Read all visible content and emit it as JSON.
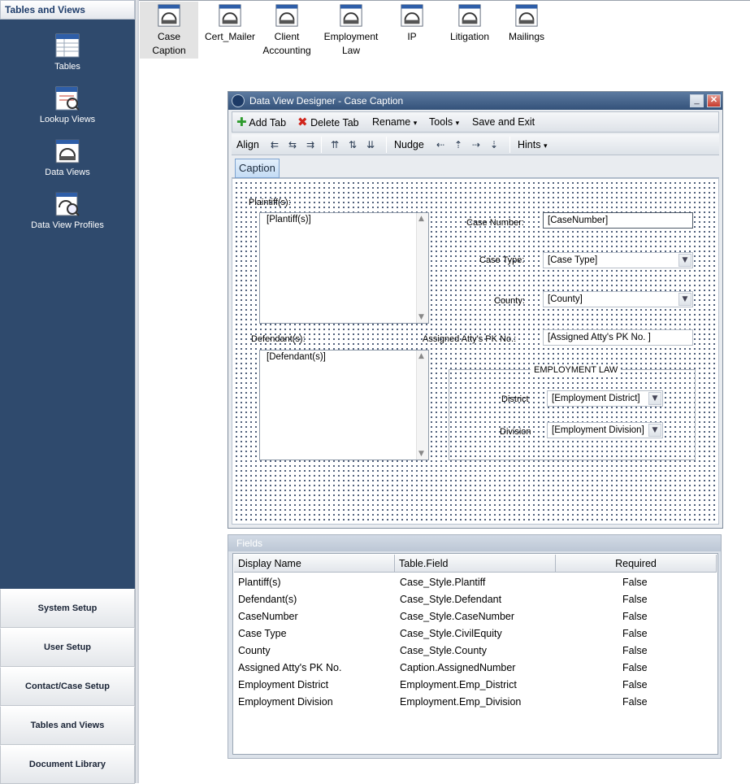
{
  "left_nav": {
    "header": "Tables and Views",
    "icon_items": [
      {
        "label": "Tables",
        "icon": "table-icon"
      },
      {
        "label": "Lookup Views",
        "icon": "lookup-view-icon"
      },
      {
        "label": "Data Views",
        "icon": "data-view-icon"
      },
      {
        "label": "Data View Profiles",
        "icon": "data-view-profile-icon"
      }
    ],
    "buttons": [
      "System Setup",
      "User Setup",
      "Contact/Case Setup",
      "Tables and Views",
      "Document Library"
    ]
  },
  "views": [
    {
      "label_line1": "Case",
      "label_line2": "Caption",
      "selected": true
    },
    {
      "label_line1": "Cert_Mailer",
      "label_line2": ""
    },
    {
      "label_line1": "Client",
      "label_line2": "Accounting"
    },
    {
      "label_line1": "Employment",
      "label_line2": "Law"
    },
    {
      "label_line1": "IP",
      "label_line2": ""
    },
    {
      "label_line1": "Litigation",
      "label_line2": ""
    },
    {
      "label_line1": "Mailings",
      "label_line2": ""
    }
  ],
  "designer": {
    "title": "Data View Designer - Case Caption",
    "minimize_symbol": "_",
    "close_symbol": "✕",
    "toolbar1": {
      "add_tab": "Add Tab",
      "delete_tab": "Delete Tab",
      "rename": "Rename",
      "tools": "Tools",
      "save_exit": "Save and Exit",
      "dropdown_arrow": "▾"
    },
    "toolbar2": {
      "align": "Align",
      "nudge": "Nudge",
      "hints": "Hints"
    },
    "tab_label": "Caption",
    "form": {
      "plaintiffs_label": "Plaintiff(s):",
      "plaintiffs_value": "[Plantiff(s)]",
      "defendants_label": "Defendant(s):",
      "defendants_value": "[Defendant(s)]",
      "case_number_label": "Case Number:",
      "case_number_value": "[CaseNumber]",
      "case_type_label": "Case Type:",
      "case_type_value": "[Case Type]",
      "county_label": "County:",
      "county_value": "[County]",
      "atty_label": "Assigned Atty's PK No.:",
      "atty_value": "[Assigned Atty's PK No. ]",
      "group_title": "EMPLOYMENT LAW",
      "district_label": "District",
      "district_value": "[Employment District]",
      "division_label": "Division",
      "division_value": "[Employment Division]"
    }
  },
  "fields_panel": {
    "title": "Fields",
    "columns": [
      "Display Name",
      "Table.Field",
      "Required"
    ],
    "rows": [
      {
        "display": "Plantiff(s)",
        "field": "Case_Style.Plantiff",
        "required": "False"
      },
      {
        "display": "Defendant(s)",
        "field": "Case_Style.Defendant",
        "required": "False"
      },
      {
        "display": "CaseNumber",
        "field": "Case_Style.CaseNumber",
        "required": "False"
      },
      {
        "display": "Case Type",
        "field": "Case_Style.CivilEquity",
        "required": "False"
      },
      {
        "display": "County",
        "field": "Case_Style.County",
        "required": "False"
      },
      {
        "display": "Assigned Atty's PK No.",
        "field": "Caption.AssignedNumber",
        "required": "False"
      },
      {
        "display": "Employment District",
        "field": "Employment.Emp_District",
        "required": "False"
      },
      {
        "display": "Employment Division",
        "field": "Employment.Emp_Division",
        "required": "False"
      }
    ]
  }
}
